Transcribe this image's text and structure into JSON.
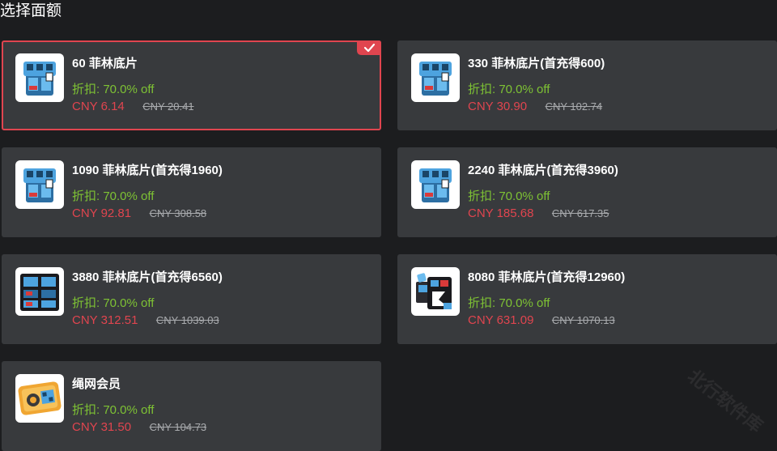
{
  "section_title": "选择面额",
  "watermark": "北行软件库",
  "colors": {
    "background": "#1c1d1f",
    "card": "#383a3d",
    "accent_red": "#e0454f",
    "discount_green": "#7ec234"
  },
  "cards": [
    {
      "name": "60 菲林底片",
      "discount": "折扣: 70.0% off",
      "price": "CNY 6.14",
      "original_price": "CNY 20.41",
      "icon": "film-box-icon",
      "selected": true
    },
    {
      "name": "330 菲林底片(首充得600)",
      "discount": "折扣: 70.0% off",
      "price": "CNY 30.90",
      "original_price": "CNY 102.74",
      "icon": "film-box-icon",
      "selected": false
    },
    {
      "name": "1090 菲林底片(首充得1960)",
      "discount": "折扣: 70.0% off",
      "price": "CNY 92.81",
      "original_price": "CNY 308.58",
      "icon": "film-box-icon",
      "selected": false
    },
    {
      "name": "2240 菲林底片(首充得3960)",
      "discount": "折扣: 70.0% off",
      "price": "CNY 185.68",
      "original_price": "CNY 617.35",
      "icon": "film-box-icon",
      "selected": false
    },
    {
      "name": "3880 菲林底片(首充得6560)",
      "discount": "折扣: 70.0% off",
      "price": "CNY 312.51",
      "original_price": "CNY 1039.03",
      "icon": "film-crate-icon",
      "selected": false
    },
    {
      "name": "8080 菲林底片(首充得12960)",
      "discount": "折扣: 70.0% off",
      "price": "CNY 631.09",
      "original_price": "CNY 1070.13",
      "icon": "film-bundle-icon",
      "selected": false
    },
    {
      "name": "绳网会员",
      "discount": "折扣: 70.0% off",
      "price": "CNY 31.50",
      "original_price": "CNY 104.73",
      "icon": "membership-card-icon",
      "selected": false
    }
  ]
}
